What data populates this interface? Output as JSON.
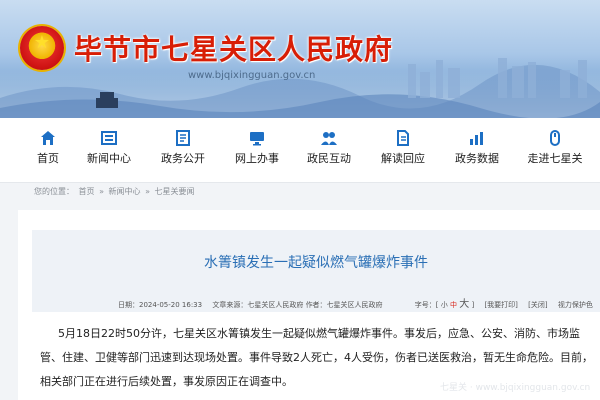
{
  "site": {
    "title": "毕节市七星关区人民政府",
    "url": "www.bjqixingguan.gov.cn"
  },
  "nav": [
    {
      "label": "首页",
      "icon": "home-icon"
    },
    {
      "label": "新闻中心",
      "icon": "news-icon"
    },
    {
      "label": "政务公开",
      "icon": "gov-open-icon"
    },
    {
      "label": "网上办事",
      "icon": "monitor-icon"
    },
    {
      "label": "政民互动",
      "icon": "people-icon"
    },
    {
      "label": "解读回应",
      "icon": "document-icon"
    },
    {
      "label": "政务数据",
      "icon": "chart-icon"
    },
    {
      "label": "走进七星关",
      "icon": "mouse-icon"
    }
  ],
  "breadcrumb": {
    "prefix": "您的位置：",
    "items": [
      "首页",
      "新闻中心",
      "七星关要闻"
    ],
    "sep": "»"
  },
  "article": {
    "title": "水箐镇发生一起疑似燃气罐爆炸事件",
    "date_label": "日期：",
    "date": "2024-05-20 16:33",
    "source_label": "文章来源：",
    "source": "七星关区人民政府",
    "author_label": "作者：",
    "author": "七星关区人民政府",
    "font_label": "字号：",
    "font_small": "小",
    "font_medium": "中",
    "font_large": "大",
    "print": "[我要打印]",
    "close": "[关闭]",
    "eyecare": "视力保护色",
    "body": "5月18日22时50分许，七星关区水箐镇发生一起疑似燃气罐爆炸事件。事发后，应急、公安、消防、市场监管、住建、卫健等部门迅速到达现场处置。事件导致2人死亡，4人受伤，伤者已送医救治，暂无生命危险。目前，相关部门正在进行后续处置，事发原因正在调查中。"
  },
  "watermark": "七星关 · www.bjqixingguan.gov.cn"
}
